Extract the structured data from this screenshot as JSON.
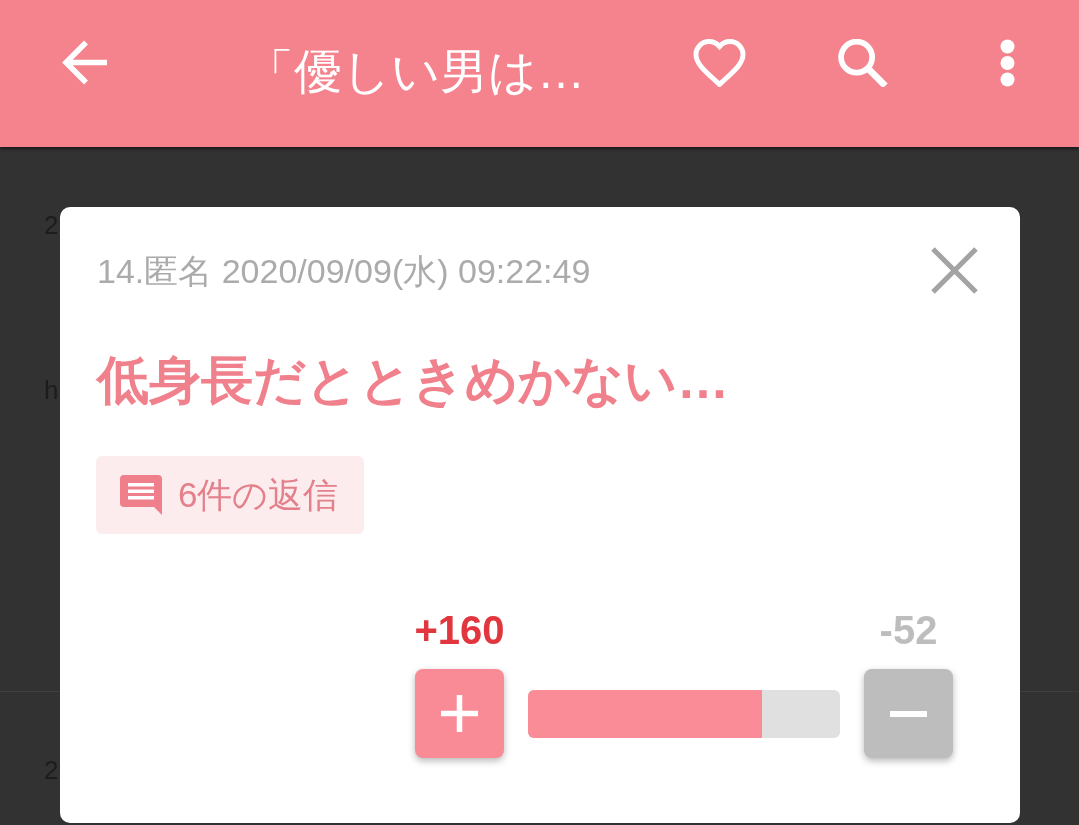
{
  "app_bar": {
    "title": "「優しい男は…"
  },
  "background_items": [
    {
      "lines": [
        "2",
        "h"
      ]
    },
    {
      "lines": [
        "2"
      ]
    }
  ],
  "comment_dialog": {
    "meta": "14.匿名 2020/09/09(水) 09:22:49",
    "comment": "低身長だとときめかない…",
    "reply_chip": {
      "label": "6件の返信"
    },
    "votes": {
      "plus_count": "+160",
      "minus_count": "-52",
      "level": 0.75
    }
  }
}
